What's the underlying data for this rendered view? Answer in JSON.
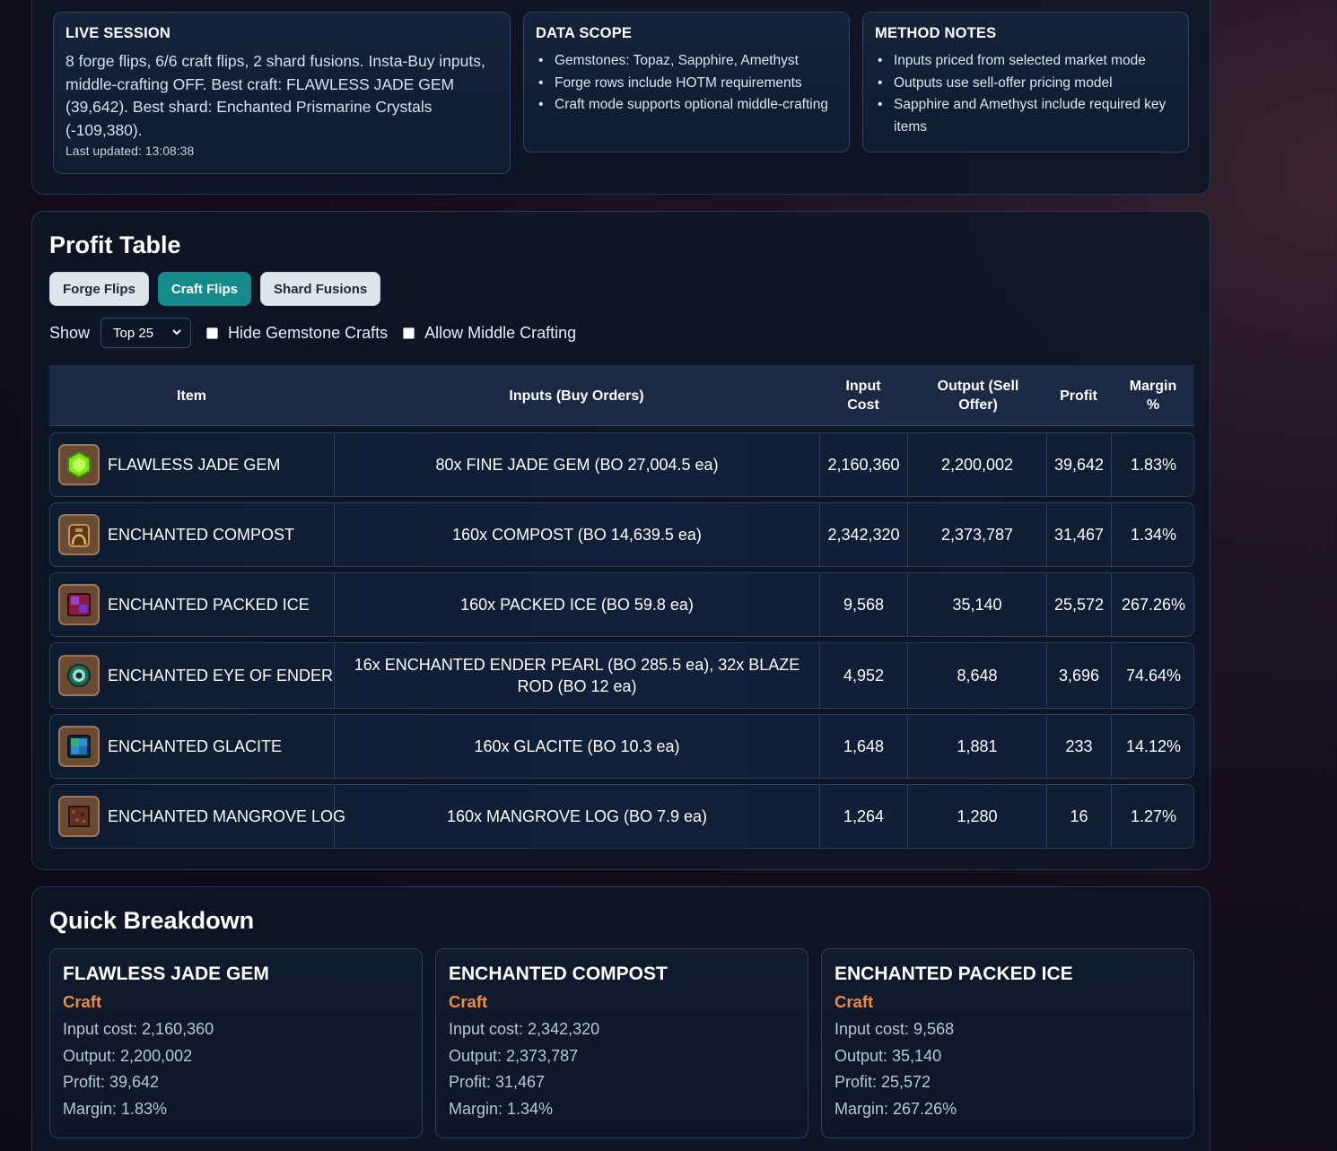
{
  "live_session": {
    "title": "LIVE SESSION",
    "summary": "8 forge flips, 6/6 craft flips, 2 shard fusions. Insta-Buy inputs, middle-crafting OFF. Best craft: FLAWLESS JADE GEM (39,642). Best shard: Enchanted Prismarine Crystals (-109,380).",
    "updated": "Last updated: 13:08:38"
  },
  "data_scope": {
    "title": "DATA SCOPE",
    "items": [
      "Gemstones: Topaz, Sapphire, Amethyst",
      "Forge rows include HOTM requirements",
      "Craft mode supports optional middle-crafting"
    ]
  },
  "method_notes": {
    "title": "METHOD NOTES",
    "items": [
      "Inputs priced from selected market mode",
      "Outputs use sell-offer pricing model",
      "Sapphire and Amethyst include required key items"
    ]
  },
  "profit_table": {
    "title": "Profit Table",
    "tabs": [
      "Forge Flips",
      "Craft Flips",
      "Shard Fusions"
    ],
    "active_tab": "Craft Flips",
    "show_label": "Show",
    "show_value": "Top 25",
    "hide_gemstone_label": "Hide Gemstone Crafts",
    "allow_middle_label": "Allow Middle Crafting",
    "columns": [
      "Item",
      "Inputs (Buy Orders)",
      "Input Cost",
      "Output (Sell Offer)",
      "Profit",
      "Margin %"
    ],
    "rows": [
      {
        "item": "FLAWLESS JADE GEM",
        "icon": "jade-gem-icon",
        "inputs": "80x FINE JADE GEM (BO 27,004.5 ea)",
        "input_cost": "2,160,360",
        "output": "2,200,002",
        "profit": "39,642",
        "margin": "1.83%"
      },
      {
        "item": "ENCHANTED COMPOST",
        "icon": "compost-icon",
        "inputs": "160x COMPOST (BO 14,639.5 ea)",
        "input_cost": "2,342,320",
        "output": "2,373,787",
        "profit": "31,467",
        "margin": "1.34%"
      },
      {
        "item": "ENCHANTED PACKED ICE",
        "icon": "packed-ice-icon",
        "inputs": "160x PACKED ICE (BO 59.8 ea)",
        "input_cost": "9,568",
        "output": "35,140",
        "profit": "25,572",
        "margin": "267.26%"
      },
      {
        "item": "ENCHANTED EYE OF ENDER",
        "icon": "eye-of-ender-icon",
        "inputs": "16x ENCHANTED ENDER PEARL (BO 285.5 ea), 32x BLAZE ROD (BO 12 ea)",
        "input_cost": "4,952",
        "output": "8,648",
        "profit": "3,696",
        "margin": "74.64%"
      },
      {
        "item": "ENCHANTED GLACITE",
        "icon": "glacite-icon",
        "inputs": "160x GLACITE (BO 10.3 ea)",
        "input_cost": "1,648",
        "output": "1,881",
        "profit": "233",
        "margin": "14.12%"
      },
      {
        "item": "ENCHANTED MANGROVE LOG",
        "icon": "mangrove-log-icon",
        "inputs": "160x MANGROVE LOG (BO 7.9 ea)",
        "input_cost": "1,264",
        "output": "1,280",
        "profit": "16",
        "margin": "1.27%"
      }
    ]
  },
  "quick_breakdown": {
    "title": "Quick Breakdown",
    "cards": [
      {
        "name": "FLAWLESS JADE GEM",
        "kind": "Craft",
        "input_cost": "Input cost: 2,160,360",
        "output": "Output: 2,200,002",
        "profit": "Profit: 39,642",
        "margin": "Margin: 1.83%"
      },
      {
        "name": "ENCHANTED COMPOST",
        "kind": "Craft",
        "input_cost": "Input cost: 2,342,320",
        "output": "Output: 2,373,787",
        "profit": "Profit: 31,467",
        "margin": "Margin: 1.34%"
      },
      {
        "name": "ENCHANTED PACKED ICE",
        "kind": "Craft",
        "input_cost": "Input cost: 9,568",
        "output": "Output: 35,140",
        "profit": "Profit: 25,572",
        "margin": "Margin: 267.26%"
      }
    ]
  },
  "colors": {
    "active_tab": "#158a8a",
    "craft_label": "#f08a3e",
    "panel_border": "#2a3a55"
  }
}
